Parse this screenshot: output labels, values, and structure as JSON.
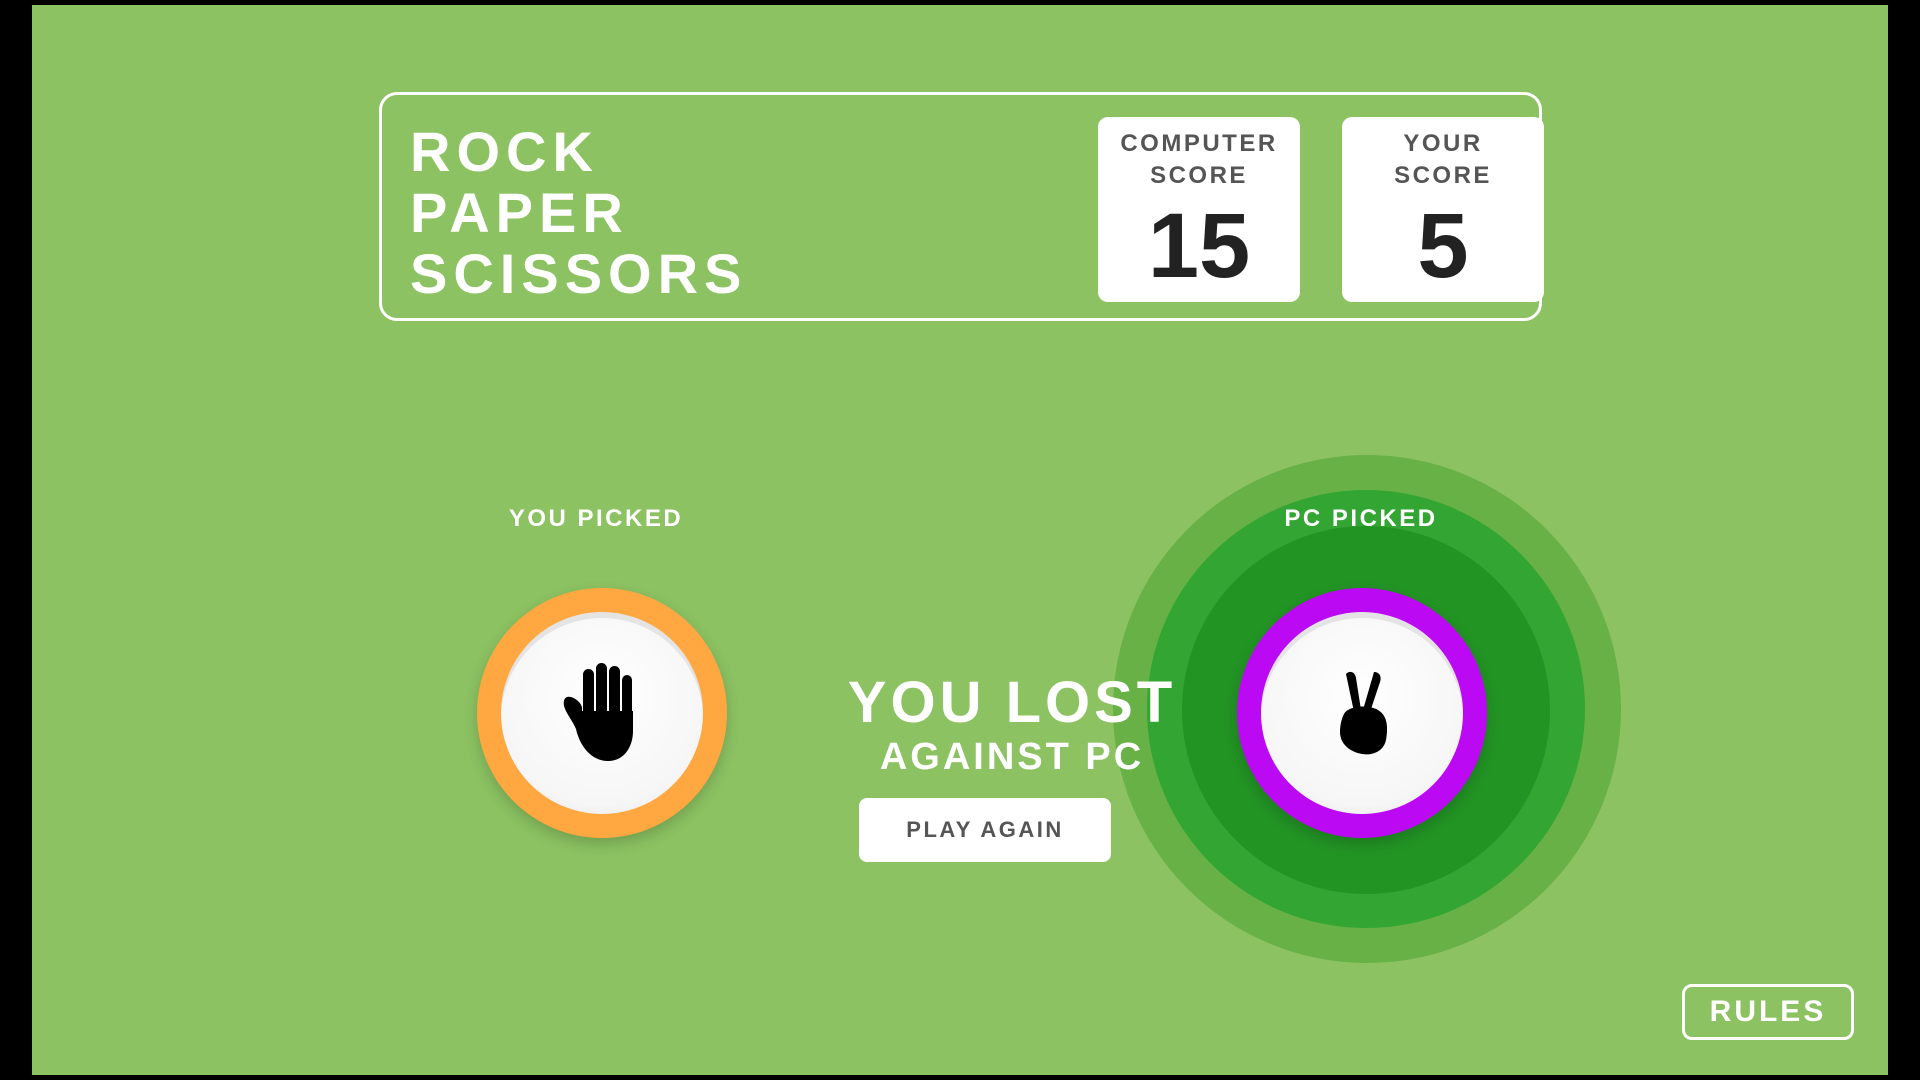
{
  "game": {
    "title_lines": [
      "ROCK",
      "PAPER",
      "SCISSORS"
    ]
  },
  "scores": {
    "computer": {
      "label": "COMPUTER\nSCORE",
      "value": "15"
    },
    "user": {
      "label": "YOUR\nSCORE",
      "value": "5"
    }
  },
  "picks": {
    "user": {
      "label": "YOU PICKED",
      "choice": "paper",
      "icon": "hand-paper-icon",
      "ring_color": "#ffa741"
    },
    "pc": {
      "label": "PC PICKED",
      "choice": "scissors",
      "icon": "hand-scissors-icon",
      "ring_color": "#bb09f3",
      "winner": true
    }
  },
  "result": {
    "main": "YOU LOST",
    "sub": "AGAINST PC",
    "play_again_label": "PLAY AGAIN"
  },
  "rules_label": "RULES",
  "colors": {
    "background": "#8cc262",
    "paper": "#ffa741",
    "scissors": "#bb09f3",
    "winner_glow": "#229424"
  }
}
